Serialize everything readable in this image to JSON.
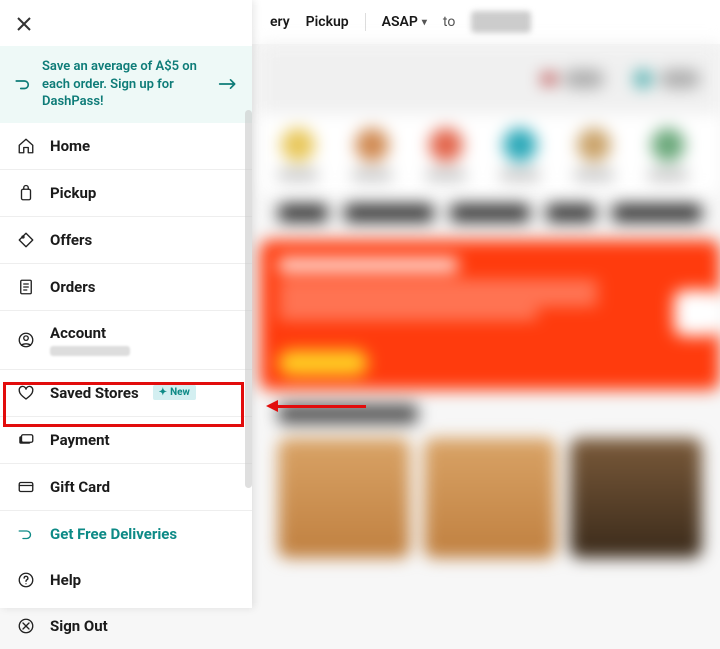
{
  "colors": {
    "teal": "#0d8a86",
    "highlight": "#e20c0c",
    "banner": "#ff3b0d"
  },
  "topbar": {
    "delivery_label": "ery",
    "pickup_label": "Pickup",
    "asap_label": "ASAP",
    "to_label": "to"
  },
  "dashpass": {
    "text": "Save an average of A$5 on each order. Sign up for DashPass!"
  },
  "menu": {
    "home": "Home",
    "pickup": "Pickup",
    "offers": "Offers",
    "orders": "Orders",
    "account": "Account",
    "saved_stores": "Saved Stores",
    "saved_stores_badge": "New",
    "payment": "Payment",
    "gift_card": "Gift Card",
    "get_free_deliveries": "Get Free Deliveries",
    "help": "Help",
    "sign_out": "Sign Out"
  }
}
